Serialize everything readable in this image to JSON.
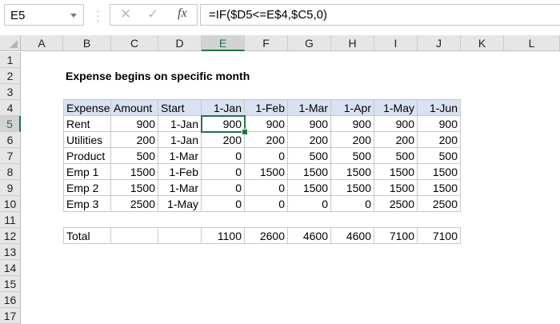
{
  "formula_bar": {
    "name_box": "E5",
    "cancel_icon": "✕",
    "enter_icon": "✓",
    "fx_label": "fx",
    "formula": "=IF($D5<=E$4,$C5,0)"
  },
  "columns": [
    "A",
    "B",
    "C",
    "D",
    "E",
    "F",
    "G",
    "H",
    "I",
    "J",
    "K",
    "L"
  ],
  "rows": [
    "1",
    "2",
    "3",
    "4",
    "5",
    "6",
    "7",
    "8",
    "9",
    "10",
    "11",
    "12",
    "13",
    "14",
    "15",
    "16",
    "17"
  ],
  "selected_cell": "E5",
  "accent_color": "#217346",
  "header_fill": "#d9e1f2",
  "sheet": {
    "title": "Expense begins on specific month",
    "table_headers": [
      "Expense",
      "Amount",
      "Start",
      "1-Jan",
      "1-Feb",
      "1-Mar",
      "1-Apr",
      "1-May",
      "1-Jun"
    ],
    "table_rows": [
      [
        "Rent",
        "900",
        "1-Jan",
        "900",
        "900",
        "900",
        "900",
        "900",
        "900"
      ],
      [
        "Utilities",
        "200",
        "1-Jan",
        "200",
        "200",
        "200",
        "200",
        "200",
        "200"
      ],
      [
        "Product",
        "500",
        "1-Mar",
        "0",
        "0",
        "500",
        "500",
        "500",
        "500"
      ],
      [
        "Emp 1",
        "1500",
        "1-Feb",
        "0",
        "1500",
        "1500",
        "1500",
        "1500",
        "1500"
      ],
      [
        "Emp 2",
        "1500",
        "1-Mar",
        "0",
        "0",
        "1500",
        "1500",
        "1500",
        "1500"
      ],
      [
        "Emp 3",
        "2500",
        "1-May",
        "0",
        "0",
        "0",
        "0",
        "2500",
        "2500"
      ]
    ],
    "total_row": [
      "Total",
      "",
      "",
      "1100",
      "2600",
      "4600",
      "4600",
      "7100",
      "7100"
    ]
  }
}
